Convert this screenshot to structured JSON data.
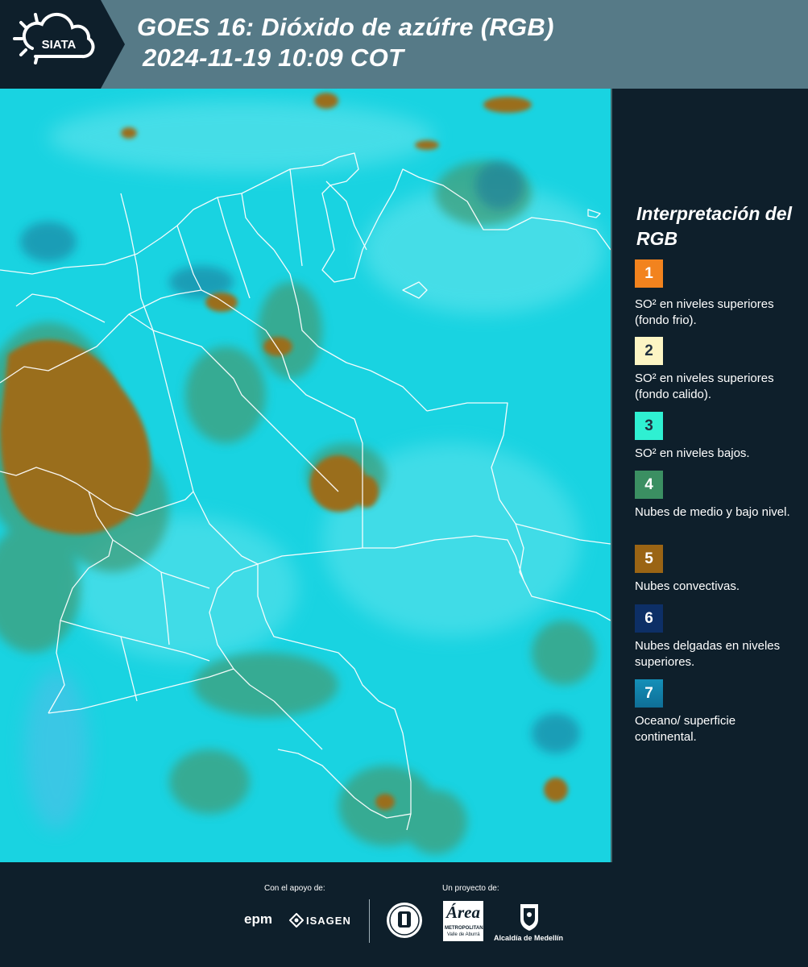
{
  "header": {
    "logo_text": "SIATA",
    "title_line1": "GOES 16: Dióxido de azúfre (RGB)",
    "title_line2": "2024-11-19 10:09 COT"
  },
  "map": {
    "icon": "satellite-map-image"
  },
  "legend": {
    "title": "Interpretación del RGB",
    "items": [
      {
        "number": "1",
        "color": "#f2831e",
        "text": "SO² en niveles superiores (fondo frio)."
      },
      {
        "number": "2",
        "color": "#fcf5c4",
        "text": "SO² en niveles superiores (fondo calido)."
      },
      {
        "number": "3",
        "color": "#2ff0d2",
        "text": "SO² en niveles bajos."
      },
      {
        "number": "4",
        "color": "#3b8f62",
        "text": "Nubes de medio y bajo nivel."
      },
      {
        "number": "5",
        "color": "#9a6414",
        "text": "Nubes convectivas."
      },
      {
        "number": "6",
        "color": "#0d2f66",
        "text": "Nubes delgadas en niveles superiores."
      },
      {
        "number": "7",
        "color": "#148fb8",
        "text": "Oceano/ superficie continental."
      }
    ]
  },
  "footer": {
    "support_label": "Con el apoyo de:",
    "project_label": "Un proyecto de:",
    "epm": "epm",
    "isagen": "ISAGEN",
    "area_logo": "Área",
    "area_sub1": "METROPOLITANA",
    "area_sub2": "Valle de Aburrá",
    "alcaldia": "Alcaldía de Medellín"
  }
}
